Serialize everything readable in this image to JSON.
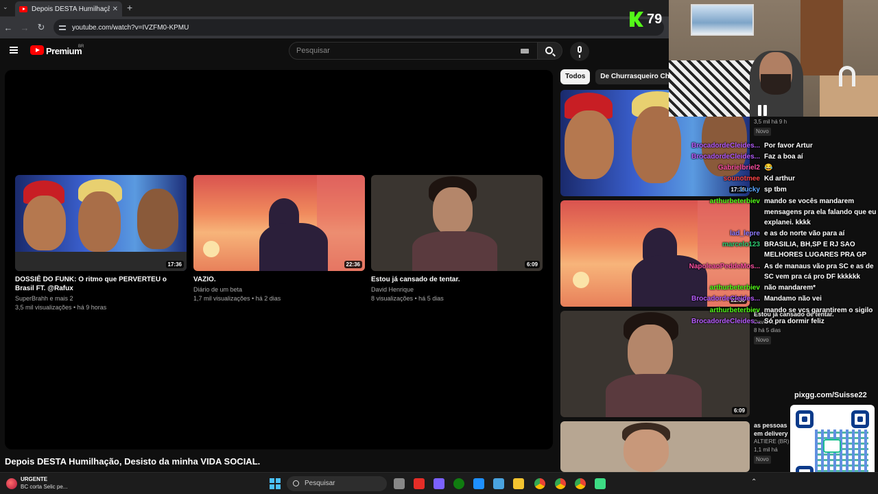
{
  "browser": {
    "tab_title": "Depois DESTA Humilhação, Des",
    "url": "youtube.com/watch?v=IVZFM0-KPMU"
  },
  "youtube": {
    "brand": "Premium",
    "region": "BR",
    "search_placeholder": "Pesquisar"
  },
  "endscreen": [
    {
      "title_line1": "DOSSIÊ DO FUNK: O ritmo que PERVERTEU o",
      "title_line2": "Brasil FT. @Rafux",
      "channel": "SuperBrahh e mais 2",
      "stats": "3,5 mil visualizações • há 9 horas",
      "duration": "17:36"
    },
    {
      "title_line1": "VAZIO.",
      "title_line2": "",
      "channel": "Diário de um beta",
      "stats": "1,7 mil visualizações • há 2 dias",
      "duration": "22:36"
    },
    {
      "title_line1": "Estou já cansado de tentar.",
      "title_line2": "",
      "channel": "David Henrique",
      "stats": "8 visualizações • há 5 dias",
      "duration": "6:09"
    }
  ],
  "video_title": "Depois DESTA Humilhação, Desisto da minha VIDA SOCIAL.",
  "chips": [
    "Todos",
    "De Churrasqueiro Churra"
  ],
  "sidebar": [
    {
      "duration": "17:36",
      "stats_line": "3,5 mil   há 9 h",
      "badge": "Novo"
    },
    {
      "duration": "22:36",
      "stats_line": "",
      "badge": ""
    },
    {
      "duration": "6:09",
      "title_fragment": "Estou já cansado de tentar.",
      "channel_fragment": "David H...",
      "stats_line": "8   há 5 dias",
      "badge": "Novo"
    },
    {
      "title_line1": "as pessoas",
      "title_line2": "em delivery",
      "channel": "ALTIERE (BR)",
      "stats_line": "1,1 mil   há",
      "badge": "Novo"
    }
  ],
  "stream": {
    "viewer_count": "79",
    "qr_label": "pixgg.com/Suisse22"
  },
  "chat": [
    {
      "user": "BrocadordeCleides...",
      "msg": "Por favor Artur",
      "color": "#b85cff"
    },
    {
      "user": "BrocadordeCleides...",
      "msg": "Faz a boa aí",
      "color": "#b85cff"
    },
    {
      "user": "Gabrielbriel2",
      "msg": "😂",
      "color": "#ff4fa3"
    },
    {
      "user": "sounotmee",
      "msg": "Kd arthur",
      "color": "#ff4545"
    },
    {
      "user": "Lucky",
      "msg": "sp tbm",
      "color": "#5aa7ff"
    },
    {
      "user": "arthurbeterbiev",
      "msg": "mando se vocês mandarem",
      "color": "#53fc18"
    },
    {
      "user": "",
      "msg": "mensagens pra ela falando que eu",
      "color": "#fff"
    },
    {
      "user": "",
      "msg": "explanei. kkkk",
      "color": "#fff"
    },
    {
      "user": "lad_lepre",
      "msg": "e as do norte vão para aí",
      "color": "#8f7bff"
    },
    {
      "user": "marcelo123",
      "msg": "BRASILIA, BH,SP E RJ SAO",
      "color": "#2ecc71"
    },
    {
      "user": "",
      "msg": "MELHORES LUGARES PRA GP",
      "color": "#fff"
    },
    {
      "user": "NapoleaoPeddeMos...",
      "msg": "As de manaus vão pra SC e as de",
      "color": "#ff4fa3"
    },
    {
      "user": "",
      "msg": "SC vem pra cá pro DF kkkkkk",
      "color": "#fff"
    },
    {
      "user": "arthurbeterbiev",
      "msg": "não mandarem*",
      "color": "#53fc18"
    },
    {
      "user": "BrocadordeCleides...",
      "msg": "Mandamo não vei",
      "color": "#b85cff"
    },
    {
      "user": "arthurbeterbiev",
      "msg": "mando se vcs garantirem o sigilo",
      "color": "#53fc18"
    },
    {
      "user": "BrocadordeCleides...",
      "msg": "Só pra dormir feliz",
      "color": "#b85cff"
    }
  ],
  "taskbar": {
    "news_title": "URGENTE",
    "news_sub": "BC corta Selic pe...",
    "search_placeholder": "Pesquisar"
  }
}
